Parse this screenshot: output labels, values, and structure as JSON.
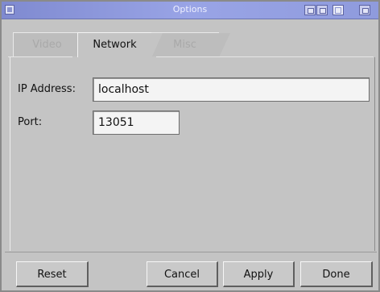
{
  "window": {
    "title": "Options"
  },
  "tabs": [
    {
      "label": "Video",
      "state": "inactive"
    },
    {
      "label": "Network",
      "state": "active"
    },
    {
      "label": "Misc",
      "state": "inactive"
    }
  ],
  "network": {
    "ip_label": "IP Address:",
    "ip_value": "localhost",
    "port_label": "Port:",
    "port_value": "13051"
  },
  "buttons": {
    "reset": "Reset",
    "cancel": "Cancel",
    "apply": "Apply",
    "done": "Done"
  },
  "colors": {
    "titlebar": "#8f9bdd",
    "window_bg": "#c4c4c4"
  }
}
